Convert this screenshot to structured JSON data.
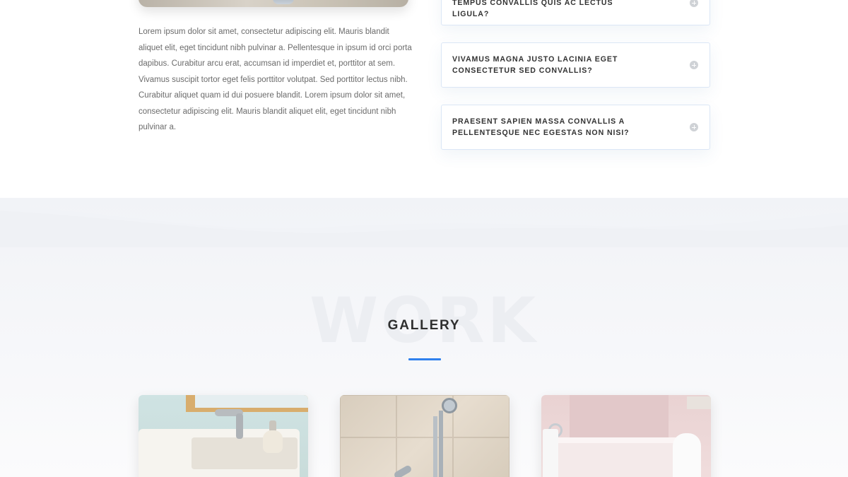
{
  "intro": {
    "paragraph": "Lorem ipsum dolor sit amet, consectetur adipiscing elit. Mauris blandit aliquet elit, eget tincidunt nibh pulvinar a. Pellentesque in ipsum id orci porta dapibus. Curabitur arcu erat, accumsan id imperdiet et, porttitor at sem. Vivamus suscipit tortor eget felis porttitor volutpat. Sed porttitor lectus nibh. Curabitur aliquet quam id dui posuere blandit. Lorem ipsum dolor sit amet, consectetur adipiscing elit. Mauris blandit aliquet elit, eget tincidunt nibh pulvinar a."
  },
  "faq": {
    "items": [
      {
        "question": "Curabitur non nulla sit amet nisl tempus convallis quis ac lectus ligula?"
      },
      {
        "question": "Vivamus magna justo lacinia eget consectetur sed convallis?"
      },
      {
        "question": "Praesent sapien massa convallis a pellentesque nec egestas non nisi?"
      }
    ],
    "toggle_icon": "plus-circle-icon"
  },
  "gallery": {
    "watermark": "WORK",
    "title": "GALLERY",
    "accent_color": "#2f80ed",
    "cards": [
      {
        "subject": "bathroom-sink-photo"
      },
      {
        "subject": "shower-fixture-photo"
      },
      {
        "subject": "bathtub-photo"
      }
    ]
  }
}
